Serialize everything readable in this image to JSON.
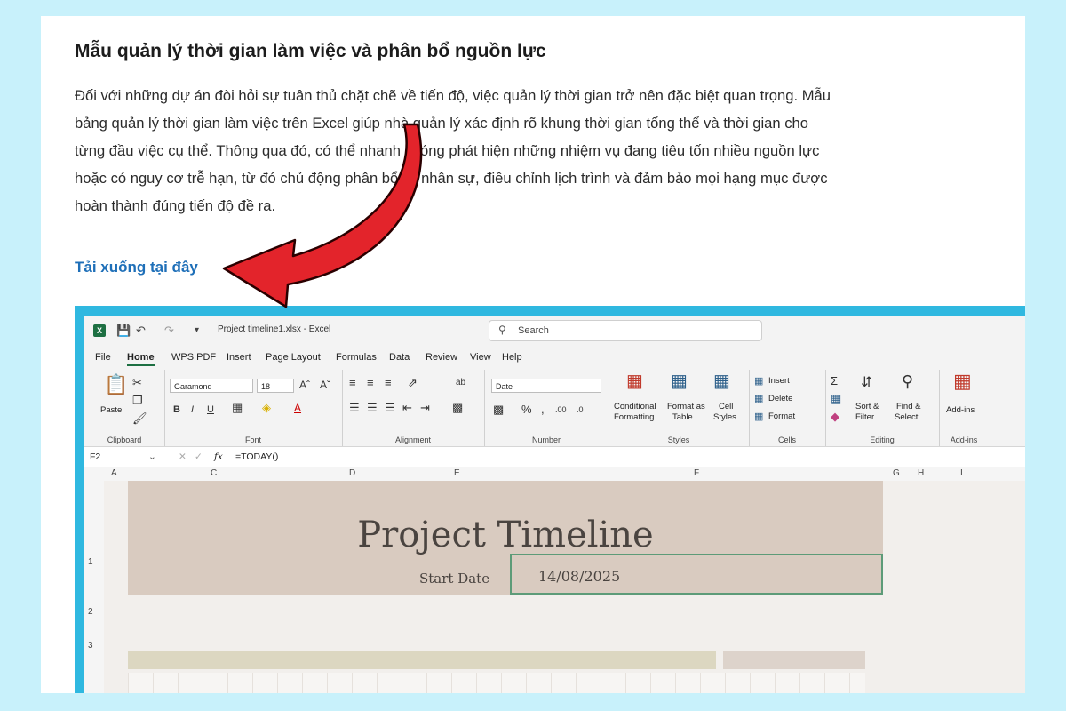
{
  "article": {
    "heading": "Mẫu quản lý thời gian làm việc và phân bổ nguồn lực",
    "lines": [
      "Đối với những dự án đòi hỏi sự tuân thủ chặt chẽ về tiến độ, việc quản lý thời gian trở nên đặc biệt quan trọng. Mẫu",
      "bảng quản lý thời gian làm việc trên Excel giúp nhà quản lý xác định rõ khung thời gian tổng thể và thời gian cho",
      "từng đầu việc cụ thể. Thông qua đó, có thể nhanh chóng phát hiện những nhiệm vụ đang tiêu tốn nhiều nguồn lực",
      "hoặc có nguy cơ trễ hạn, từ đó chủ động phân bổ lại nhân sự, điều chỉnh lịch trình và đảm bảo mọi hạng mục được",
      "hoàn thành đúng tiến độ đề ra."
    ],
    "download_link": "Tải xuống tại đây"
  },
  "colors": {
    "page_bg": "#c8f1fb",
    "link": "#1e6fb8",
    "arrow": "#e3242b",
    "excel_green": "#1d6f42",
    "banner": "#d9cbc0"
  },
  "excel": {
    "file_title": "Project timeline1.xlsx - Excel",
    "search_placeholder": "Search",
    "menu": [
      "File",
      "Home",
      "WPS PDF",
      "Insert",
      "Page Layout",
      "Formulas",
      "Data",
      "Review",
      "View",
      "Help"
    ],
    "ribbon": {
      "paste": "Paste",
      "clipboard": "Clipboard",
      "font_name": "Garamond",
      "font_size": "18",
      "font_group": "Font",
      "alignment_group": "Alignment",
      "number_format": "Date",
      "number_group": "Number",
      "conditional": "Conditional",
      "formatting": "Formatting",
      "format_as": "Format as",
      "table": "Table",
      "cell": "Cell",
      "styles": "Styles",
      "styles_group": "Styles",
      "insert": "Insert",
      "delete": "Delete",
      "format": "Format",
      "cells_group": "Cells",
      "sort": "Sort &",
      "filter": "Filter",
      "find": "Find &",
      "select": "Select",
      "editing_group": "Editing",
      "addins": "Add-ins",
      "addins_group": "Add-ins"
    },
    "name_box": "F2",
    "formula": "=TODAY()",
    "columns": [
      "A",
      "C",
      "D",
      "E",
      "F",
      "G",
      "H",
      "I"
    ],
    "rows": [
      "1",
      "2",
      "3"
    ],
    "sheet_title": "Project Timeline",
    "start_date_label": "Start Date",
    "start_date_value": "14/08/2025"
  }
}
